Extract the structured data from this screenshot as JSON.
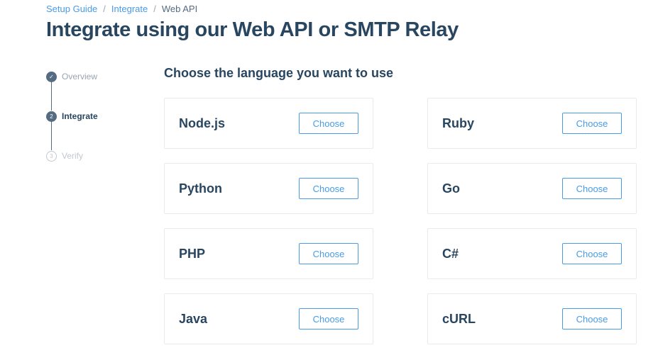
{
  "breadcrumb": {
    "items": [
      "Setup Guide",
      "Integrate"
    ],
    "current": "Web API",
    "separator": "/"
  },
  "page": {
    "title": "Integrate using our Web API or SMTP Relay",
    "section_title": "Choose the language you want to use"
  },
  "steps": [
    {
      "marker": "✓",
      "label": "Overview",
      "state": "complete"
    },
    {
      "marker": "2",
      "label": "Integrate",
      "state": "current"
    },
    {
      "marker": "3",
      "label": "Verify",
      "state": "upcoming"
    }
  ],
  "languages": [
    {
      "name": "Node.js",
      "button": "Choose"
    },
    {
      "name": "Ruby",
      "button": "Choose"
    },
    {
      "name": "Python",
      "button": "Choose"
    },
    {
      "name": "Go",
      "button": "Choose"
    },
    {
      "name": "PHP",
      "button": "Choose"
    },
    {
      "name": "C#",
      "button": "Choose"
    },
    {
      "name": "Java",
      "button": "Choose"
    },
    {
      "name": "cURL",
      "button": "Choose"
    }
  ],
  "colors": {
    "primary_text": "#294661",
    "link": "#489be8",
    "muted": "#9aa5b1",
    "border": "#e9ecef"
  }
}
